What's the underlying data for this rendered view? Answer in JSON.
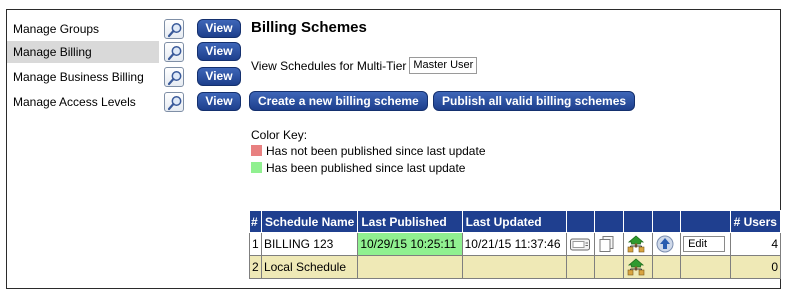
{
  "sidebar": {
    "items": [
      {
        "label": "Manage Groups",
        "view_label": "View"
      },
      {
        "label": "Manage Billing",
        "view_label": "View"
      },
      {
        "label": "Manage Business Billing",
        "view_label": "View"
      },
      {
        "label": "Manage Access Levels",
        "view_label": "View"
      }
    ],
    "active_index": 1
  },
  "main": {
    "title": "Billing Schemes",
    "multi_tier_label": "View Schedules for Multi-Tier",
    "multi_tier_value": "Master User",
    "create_button": "Create a new billing scheme",
    "publish_button": "Publish all valid billing schemes",
    "color_key": {
      "title": "Color Key:",
      "items": [
        {
          "label": "Has not been published since last update",
          "color": "#e88080"
        },
        {
          "label": "Has been published since last update",
          "color": "#90f090"
        }
      ]
    }
  },
  "table": {
    "headers": {
      "num": "#",
      "name": "Schedule Name",
      "published": "Last Published",
      "updated": "Last Updated",
      "users": "# Users"
    },
    "rows": [
      {
        "num": "1",
        "name": "BILLING 123",
        "published": "10/29/15 10:25:11",
        "updated": "10/21/15 11:37:46",
        "edit_label": "Edit",
        "users": "4",
        "icons": [
          "view-schedule-icon",
          "copy-icon",
          "tree-hierarchy-icon",
          "upload-arrow-icon"
        ]
      },
      {
        "num": "2",
        "name": "Local Schedule",
        "published": "",
        "updated": "",
        "users": "0",
        "icons": [
          "tree-hierarchy-icon"
        ]
      }
    ]
  },
  "colors": {
    "button_blue": "#1d3f8c",
    "header_blue": "#1f3f8f",
    "published_green": "#90f090",
    "unpublished_red": "#e88080",
    "row_yellow": "#efe9b6",
    "active_gray": "#d9d9d9"
  }
}
